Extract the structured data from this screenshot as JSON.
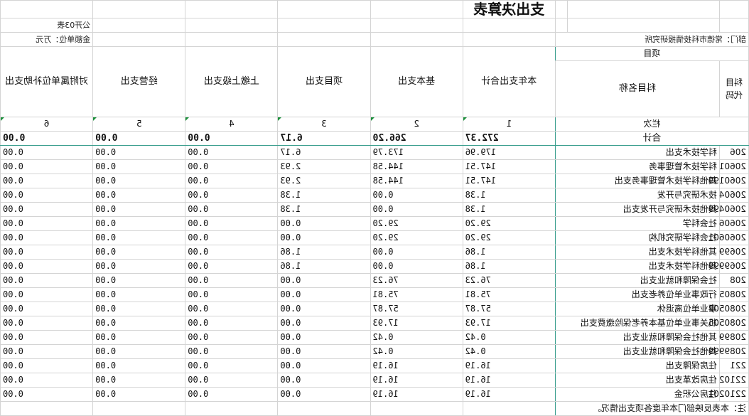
{
  "title": "支出决算表",
  "form_code": "公开03表",
  "unit_label": "金额单位：万元",
  "dept_label": "部门：常德市科技情报研究所",
  "project_label": "项目",
  "col_code_label": "科目代码",
  "col_name_label": "科目名称",
  "columns": [
    "本年支出合计",
    "基本支出",
    "项目支出",
    "上缴上级支出",
    "经营支出",
    "对附属单位补助支出"
  ],
  "col_numbers": [
    "1",
    "2",
    "3",
    "4",
    "5",
    "6"
  ],
  "row_index_label": "栏次",
  "total_label": "合计",
  "totals": [
    "272.37",
    "266.20",
    "6.17",
    "0.00",
    "0.00",
    "0.00"
  ],
  "rows": [
    {
      "code": "206",
      "name": "科学技术支出",
      "values": [
        "179.96",
        "173.79",
        "6.17",
        "0.00",
        "0.00",
        "0.00"
      ]
    },
    {
      "code": "20601",
      "name": "科学技术管理事务",
      "values": [
        "147.51",
        "144.58",
        "2.93",
        "0.00",
        "0.00",
        "0.00"
      ]
    },
    {
      "code": "2060199",
      "name": "其他科学技术管理事务支出",
      "values": [
        "147.51",
        "144.58",
        "2.93",
        "0.00",
        "0.00",
        "0.00"
      ]
    },
    {
      "code": "20604",
      "name": "技术研究与开发",
      "values": [
        "1.38",
        "0.00",
        "1.38",
        "0.00",
        "0.00",
        "0.00"
      ]
    },
    {
      "code": "2060499",
      "name": "其他技术研究与开发支出",
      "values": [
        "1.38",
        "0.00",
        "1.38",
        "0.00",
        "0.00",
        "0.00"
      ]
    },
    {
      "code": "20606",
      "name": "社会科学",
      "values": [
        "29.20",
        "29.20",
        "0.00",
        "0.00",
        "0.00",
        "0.00"
      ]
    },
    {
      "code": "2060601",
      "name": "社会科学研究机构",
      "values": [
        "29.20",
        "29.20",
        "0.00",
        "0.00",
        "0.00",
        "0.00"
      ]
    },
    {
      "code": "20699",
      "name": "其他科学技术支出",
      "values": [
        "1.86",
        "0.00",
        "1.86",
        "0.00",
        "0.00",
        "0.00"
      ]
    },
    {
      "code": "2069999",
      "name": "其他科学技术支出",
      "values": [
        "1.86",
        "0.00",
        "1.86",
        "0.00",
        "0.00",
        "0.00"
      ]
    },
    {
      "code": "208",
      "name": "社会保障和就业支出",
      "values": [
        "76.23",
        "76.23",
        "0.00",
        "0.00",
        "0.00",
        "0.00"
      ]
    },
    {
      "code": "20805",
      "name": "行政事业单位养老支出",
      "values": [
        "75.81",
        "75.81",
        "0.00",
        "0.00",
        "0.00",
        "0.00"
      ]
    },
    {
      "code": "2080502",
      "name": "事业单位离退休",
      "values": [
        "57.87",
        "57.87",
        "0.00",
        "0.00",
        "0.00",
        "0.00"
      ]
    },
    {
      "code": "2080505",
      "name": "机关事业单位基本养老保险缴费支出",
      "values": [
        "17.93",
        "17.93",
        "0.00",
        "0.00",
        "0.00",
        "0.00"
      ]
    },
    {
      "code": "20899",
      "name": "其他社会保障和就业支出",
      "values": [
        "0.42",
        "0.42",
        "0.00",
        "0.00",
        "0.00",
        "0.00"
      ]
    },
    {
      "code": "2089999",
      "name": "其他社会保障和就业支出",
      "values": [
        "0.42",
        "0.42",
        "0.00",
        "0.00",
        "0.00",
        "0.00"
      ]
    },
    {
      "code": "221",
      "name": "住房保障支出",
      "values": [
        "16.19",
        "16.19",
        "0.00",
        "0.00",
        "0.00",
        "0.00"
      ]
    },
    {
      "code": "22102",
      "name": "住房改革支出",
      "values": [
        "16.19",
        "16.19",
        "0.00",
        "0.00",
        "0.00",
        "0.00"
      ]
    },
    {
      "code": "2210201",
      "name": "住房公积金",
      "values": [
        "16.19",
        "16.19",
        "0.00",
        "0.00",
        "0.00",
        "0.00"
      ]
    }
  ],
  "footnote": "注：本表反映部门本年度各项支出情况。",
  "accent_color": "#3a9e8e",
  "marker_color": "#1a8f3a"
}
